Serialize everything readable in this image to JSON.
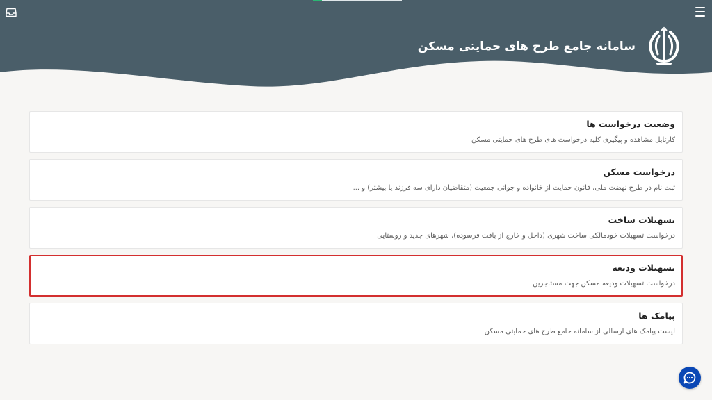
{
  "header": {
    "title": "سامانه جامع طرح های حمایتی مسکن",
    "bg_color": "#4a5e69",
    "progress_fraction": 0.1
  },
  "cards": [
    {
      "title": "وضعیت درخواست ها",
      "description": "کارتابل مشاهده و پیگیری کلیه درخواست های طرح های حمایتی مسکن"
    },
    {
      "title": "درخواست مسکن",
      "description": "ثبت نام در طرح نهضت ملی، قانون حمایت از خانواده و جوانی جمعیت (متقاضیان دارای سه فرزند یا بیشتر) و ..."
    },
    {
      "title": "تسهیلات ساخت",
      "description": "درخواست تسهیلات خودمالکی ساخت شهری (داخل و خارج از بافت فرسوده)، شهرهای جدید و روستایی"
    },
    {
      "title": "تسهیلات ودیعه",
      "description": "درخواست تسهیلات ودیعه مسکن جهت مستاجرین",
      "highlighted": true
    },
    {
      "title": "پیامک ها",
      "description": "لیست پیامک های ارسالی از سامانه جامع طرح های حمایتی مسکن"
    }
  ],
  "icons": {
    "menu": "hamburger-menu-icon",
    "inbox": "inbox-icon",
    "emblem": "iran-emblem-icon",
    "chat": "chat-support-icon"
  },
  "colors": {
    "highlight_border": "#d32f2f",
    "chat_button": "#0a47b5"
  }
}
